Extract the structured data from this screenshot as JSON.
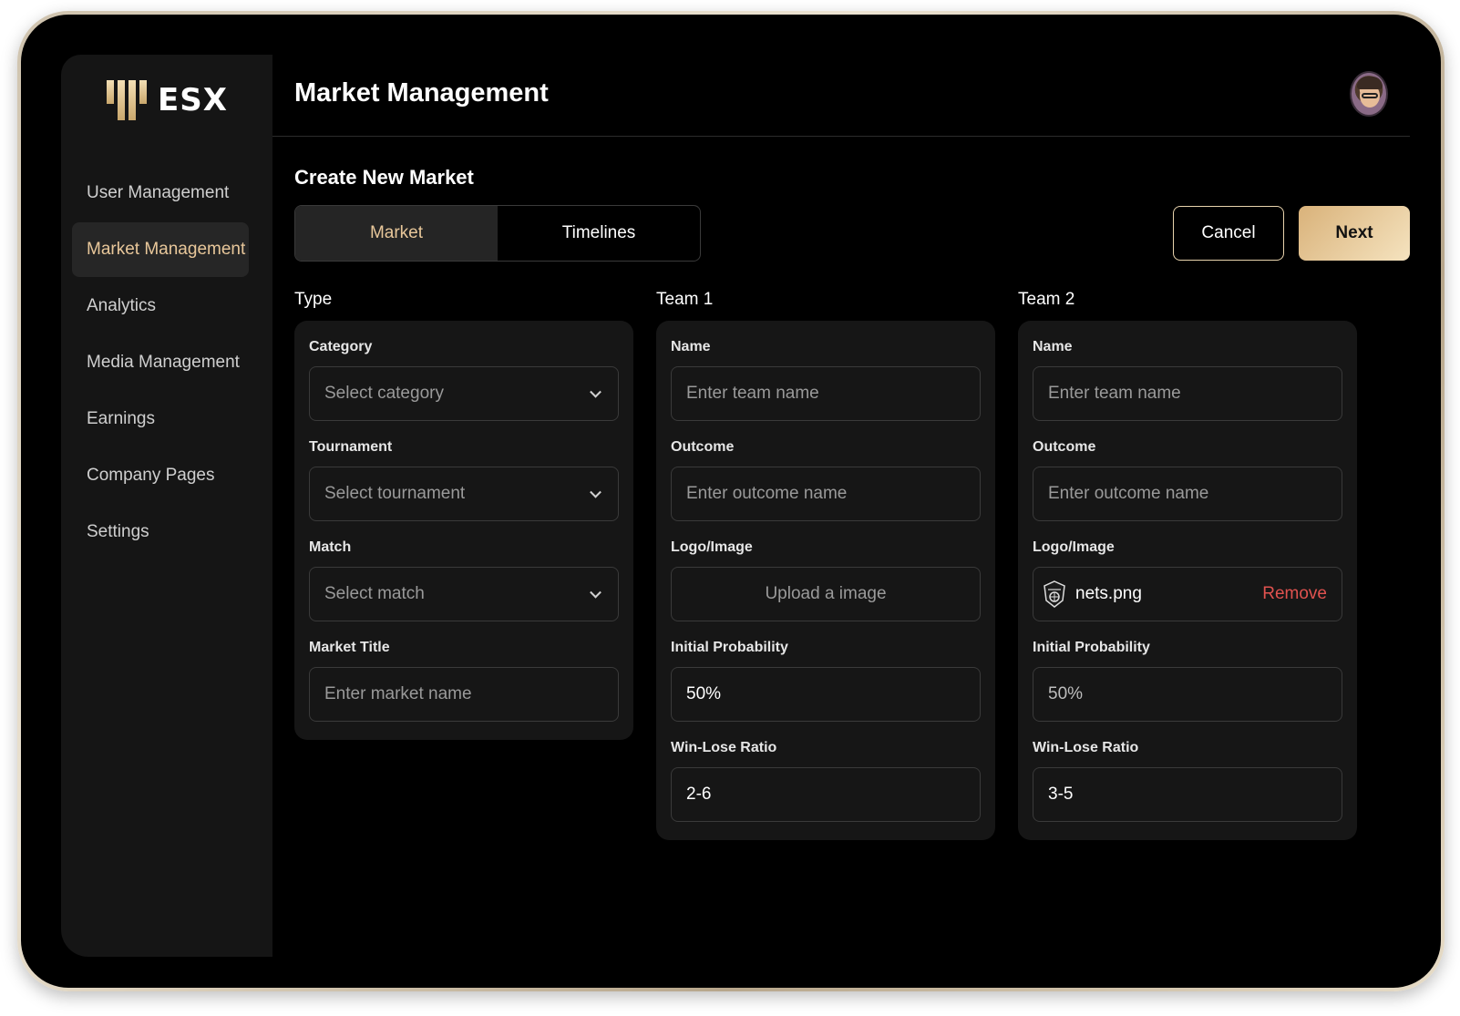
{
  "app": {
    "logo_text": "ESX"
  },
  "sidebar": {
    "items": [
      {
        "label": "User Management"
      },
      {
        "label": "Market Management"
      },
      {
        "label": "Analytics"
      },
      {
        "label": "Media Management"
      },
      {
        "label": "Earnings"
      },
      {
        "label": "Company Pages"
      },
      {
        "label": "Settings"
      }
    ]
  },
  "header": {
    "title": "Market Management"
  },
  "main": {
    "section_title": "Create New Market",
    "tabs": [
      {
        "label": "Market"
      },
      {
        "label": "Timelines"
      }
    ],
    "cancel_label": "Cancel",
    "next_label": "Next",
    "type": {
      "title": "Type",
      "category": {
        "label": "Category",
        "placeholder": "Select category"
      },
      "tournament": {
        "label": "Tournament",
        "placeholder": "Select tournament"
      },
      "match": {
        "label": "Match",
        "placeholder": "Select match"
      },
      "market_title": {
        "label": "Market Title",
        "placeholder": "Enter market name"
      }
    },
    "team1": {
      "title": "Team 1",
      "name": {
        "label": "Name",
        "placeholder": "Enter team name"
      },
      "outcome": {
        "label": "Outcome",
        "placeholder": "Enter outcome name"
      },
      "logo": {
        "label": "Logo/Image",
        "upload_text": "Upload a image"
      },
      "probability": {
        "label": "Initial Probability",
        "value": "50%"
      },
      "win_lose": {
        "label": "Win-Lose Ratio",
        "value": "2-6"
      }
    },
    "team2": {
      "title": "Team 2",
      "name": {
        "label": "Name",
        "placeholder": "Enter team name"
      },
      "outcome": {
        "label": "Outcome",
        "placeholder": "Enter outcome name"
      },
      "logo": {
        "label": "Logo/Image",
        "file_name": "nets.png",
        "remove_label": "Remove"
      },
      "probability": {
        "label": "Initial Probability",
        "value": "50%"
      },
      "win_lose": {
        "label": "Win-Lose Ratio",
        "value": "3-5"
      }
    }
  },
  "colors": {
    "accent": "#e8c79a",
    "remove": "#e0524f",
    "background": "#000000",
    "panel": "#161616"
  }
}
